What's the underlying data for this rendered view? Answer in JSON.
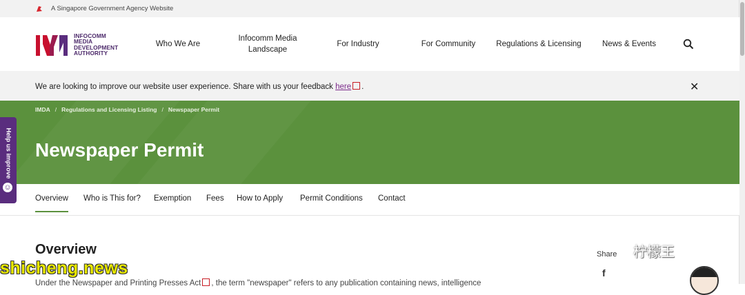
{
  "topbar": {
    "text": "A Singapore Government Agency Website"
  },
  "logo": {
    "line1": "INFOCOMM",
    "line2": "MEDIA",
    "line3": "DEVELOPMENT",
    "line4": "AUTHORITY"
  },
  "nav": {
    "who": "Who We Are",
    "landscape": "Infocomm Media Landscape",
    "industry": "For Industry",
    "community": "For Community",
    "regulations": "Regulations & Licensing",
    "news": "News & Events"
  },
  "feedback": {
    "message": "We are looking to improve our website user experience. Share with us your feedback",
    "link": "here",
    "end": "."
  },
  "breadcrumb": {
    "home": "IMDA",
    "sep": "/",
    "level2": "Regulations and Licensing Listing",
    "current": "Newspaper Permit"
  },
  "hero": {
    "title": "Newspaper Permit"
  },
  "tabs": [
    "Overview",
    "Who is This for?",
    "Exemption",
    "Fees",
    "How to Apply",
    "Permit Conditions",
    "Contact"
  ],
  "help": {
    "label": "Help us improve"
  },
  "content": {
    "heading": "Overview",
    "para_start": "Under the Newspaper and Printing Presses Act",
    "para_rest": ", the term \"newspaper\" refers to any publication containing news, intelligence"
  },
  "share": {
    "label": "Share"
  },
  "watermark": {
    "site": "shicheng.news",
    "author": "柠檬王"
  },
  "colors": {
    "brand_green": "#5b913d",
    "brand_purple": "#5a2d7e",
    "logo_red": "#c8102e"
  }
}
